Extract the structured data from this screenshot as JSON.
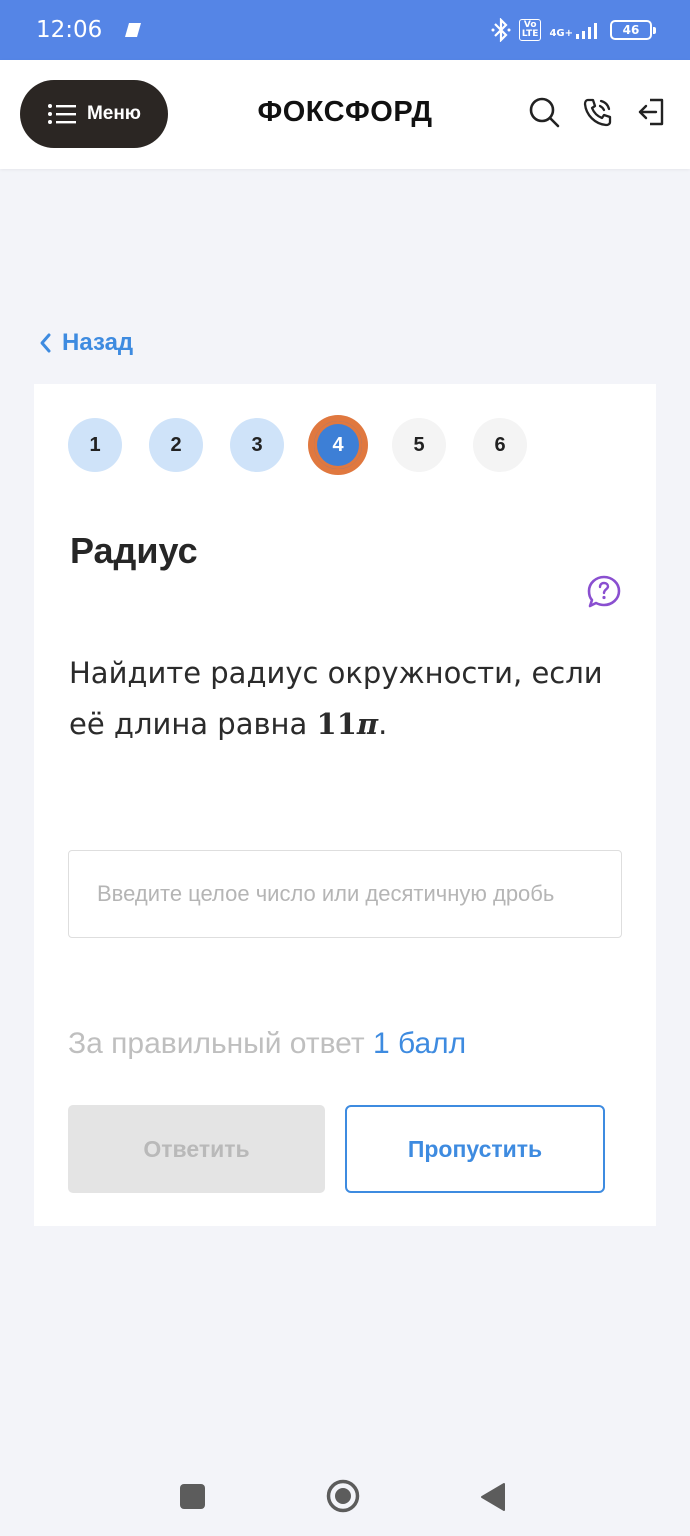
{
  "status_bar": {
    "time": "12:06",
    "volte": "Vo LTE",
    "network": "4G+",
    "battery": "46"
  },
  "header": {
    "menu_label": "Меню",
    "logo": "ФОКСФОРД",
    "icons": [
      "search-icon",
      "phone-icon",
      "logout-icon"
    ]
  },
  "back": {
    "label": "Назад"
  },
  "steps": [
    {
      "label": "1",
      "state": "done"
    },
    {
      "label": "2",
      "state": "done"
    },
    {
      "label": "3",
      "state": "done"
    },
    {
      "label": "4",
      "state": "current"
    },
    {
      "label": "5",
      "state": "todo"
    },
    {
      "label": "6",
      "state": "todo"
    }
  ],
  "task": {
    "title": "Радиус",
    "question_text": "Найдите радиус окружности, если её длина равна ",
    "question_number": "11",
    "question_pi": "π",
    "question_end": "."
  },
  "answer": {
    "value": "",
    "placeholder": "Введите целое число или десятичную дробь"
  },
  "score": {
    "prefix": "За правильный ответ ",
    "points": "1 балл"
  },
  "actions": {
    "answer_label": "Ответить",
    "skip_label": "Пропустить"
  },
  "colors": {
    "status_bar": "#5585e6",
    "accent": "#3e8be0",
    "current_step": "#3d7fd6",
    "current_step_ring": "#e0783f",
    "done_step": "#cfe3f9",
    "help_icon": "#8a4fd0"
  }
}
